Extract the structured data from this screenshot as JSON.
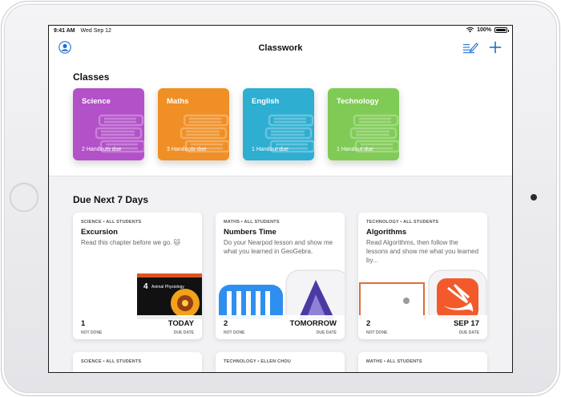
{
  "status_bar": {
    "time": "9:41 AM",
    "date": "Wed Sep 12",
    "battery": "100%"
  },
  "nav": {
    "title": "Classwork"
  },
  "classes": {
    "heading": "Classes",
    "items": [
      {
        "name": "Science",
        "due": "2 Handouts due",
        "color": "#b351c9"
      },
      {
        "name": "Maths",
        "due": "3 Handouts due",
        "color": "#ef8f25"
      },
      {
        "name": "English",
        "due": "1 Handout due",
        "color": "#2eaed1"
      },
      {
        "name": "Technology",
        "due": "1 Handout due",
        "color": "#7fcb55"
      }
    ]
  },
  "due": {
    "heading": "Due Next 7 Days",
    "cards": [
      {
        "meta": "SCIENCE • ALL STUDENTS",
        "title": "Excursion",
        "description": "Read this chapter before we go. 🐱",
        "not_done_count": "1",
        "not_done_label": "NOT DONE",
        "due_value": "TODAY",
        "due_label": "DUE DATE",
        "book_number": "4",
        "book_title": "Animal Physiology"
      },
      {
        "meta": "MATHS • ALL STUDENTS",
        "title": "Numbers Time",
        "description": "Do your Nearpod lesson and show me what you learned in GeoGebra.",
        "not_done_count": "2",
        "not_done_label": "NOT DONE",
        "due_value": "TOMORROW",
        "due_label": "DUE DATE"
      },
      {
        "meta": "TECHNOLOGY • ALL STUDENTS",
        "title": "Algorithms",
        "description": "Read Algorithms, then follow the lessons and show me what you learned by...",
        "not_done_count": "2",
        "not_done_label": "NOT DONE",
        "due_value": "SEP 17",
        "due_label": "DUE DATE"
      }
    ],
    "more": [
      {
        "meta": "SCIENCE • ALL STUDENTS"
      },
      {
        "meta": "TECHNOLOGY • ELLEN CHOU"
      },
      {
        "meta": "MATHS • ALL STUDENTS"
      }
    ]
  }
}
